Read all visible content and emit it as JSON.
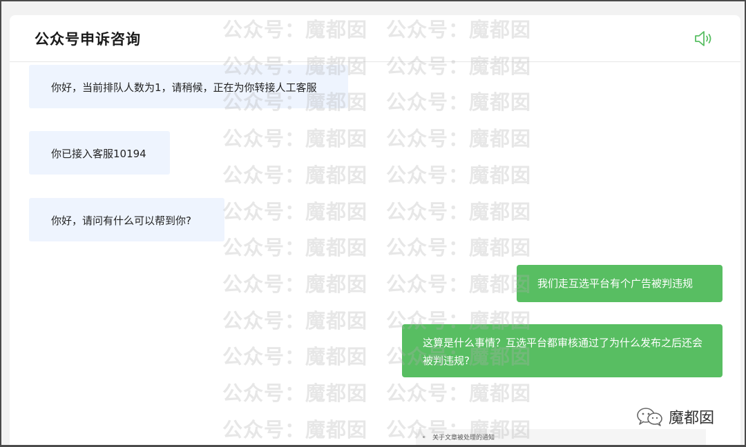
{
  "header": {
    "title": "公众号申诉咨询"
  },
  "messages": [
    {
      "side": "incoming",
      "text": "你好，当前排队人数为1，请稍候，正在为你转接人工客服"
    },
    {
      "side": "incoming",
      "text": "你已接入客服10194"
    },
    {
      "side": "incoming",
      "text": "你好，请问有什么可以帮到你?"
    },
    {
      "side": "outgoing",
      "text": "我们走互选平台有个广告被判违规"
    },
    {
      "side": "outgoing",
      "text": "这算是什么事情？互选平台都审核通过了为什么发布之后还会被判违规?"
    }
  ],
  "notice": {
    "text": "关于文章被处理的通知"
  },
  "watermark": {
    "text": "公众号：魔都囡"
  },
  "brand": {
    "name": "魔都囡",
    "icon": "wechat-icon"
  },
  "colors": {
    "accent_green": "#58be62",
    "incoming_bubble": "#eef4fe"
  }
}
